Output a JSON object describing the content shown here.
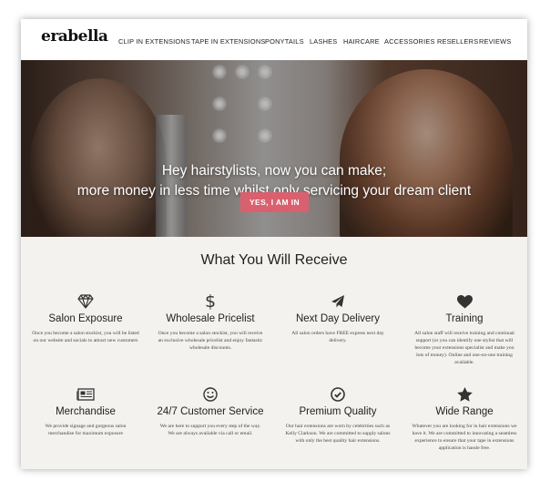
{
  "brand": {
    "logo": "erabella"
  },
  "nav": {
    "items": [
      {
        "label": "CLIP IN EXTENSIONS"
      },
      {
        "label": "TAPE IN EXTENSIONS"
      },
      {
        "label": "PONYTAILS"
      },
      {
        "label": "LASHES"
      },
      {
        "label": "HAIRCARE"
      },
      {
        "label": "ACCESSORIES"
      },
      {
        "label": "RESELLERS"
      },
      {
        "label": "REVIEWS"
      }
    ]
  },
  "hero": {
    "line1": "Hey hairstylists, now you can make;",
    "line2": "more money in less time whilst only servicing your dream client",
    "cta": "YES, I AM IN",
    "cta_color": "#d9606f"
  },
  "benefits": {
    "title": "What You Will Receive",
    "items": [
      {
        "icon": "diamond-icon",
        "title": "Salon Exposure",
        "desc": "Once you become a salon stockist, you will be listed on our website and socials to attract new customers"
      },
      {
        "icon": "dollar-icon",
        "title": "Wholesale Pricelist",
        "desc": "Once you become a salon stockist, you will receive an exclusive wholesale pricelist and enjoy fantastic wholesale discounts."
      },
      {
        "icon": "plane-icon",
        "title": "Next Day Delivery",
        "desc": "All salon orders have FREE express next day delivery."
      },
      {
        "icon": "heart-icon",
        "title": "Training",
        "desc": "All salon staff will receive training and continual support (or you can identify one stylist that will become your extensions specialist and make you lots of money). Online and one-on-one training available."
      },
      {
        "icon": "newspaper-icon",
        "title": "Merchandise",
        "desc": "We provide signage and gorgeous salon merchandise for maximum exposure"
      },
      {
        "icon": "smile-icon",
        "title": "24/7 Customer Service",
        "desc": "We are here to support you every step of the way. We are always available via call or email."
      },
      {
        "icon": "check-circle-icon",
        "title": "Premium Quality",
        "desc": "Our hair extensions are worn by celebrities such as Kelly Clarkson. We are committed to supply salons with only the best quality hair extensions."
      },
      {
        "icon": "star-icon",
        "title": "Wide Range",
        "desc": "Whatever you are looking for in hair extensions we have it. We are committed to innovating a seamless experience to ensure that your tape in extensions application is hassle free."
      }
    ]
  }
}
